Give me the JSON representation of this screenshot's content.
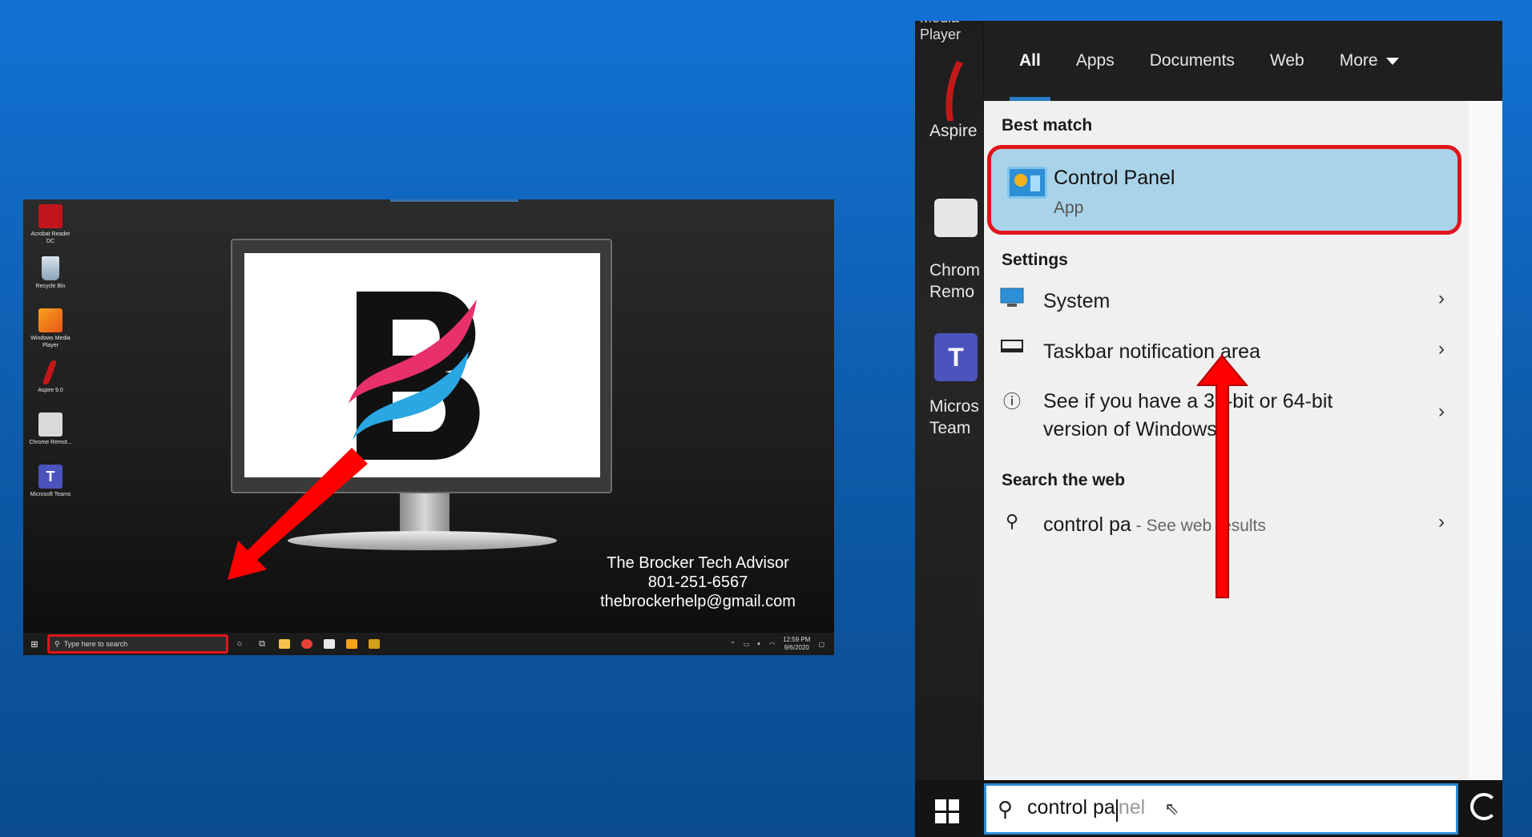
{
  "left": {
    "desktop_icons": [
      {
        "label": "Acrobat Reader DC",
        "icon": "acrobat-icon"
      },
      {
        "label": "Recycle Bin",
        "icon": "recycle-bin-icon"
      },
      {
        "label": "Windows Media Player",
        "icon": "media-player-icon"
      },
      {
        "label": "Aspire 9.0",
        "icon": "aspire-icon"
      },
      {
        "label": "Chrome Remot...",
        "icon": "chrome-remote-icon"
      },
      {
        "label": "Microsoft Teams",
        "icon": "teams-icon"
      }
    ],
    "brand": {
      "name": "The Brocker Tech Advisor",
      "phone": "801-251-6567",
      "email": "thebrockerhelp@gmail.com"
    },
    "taskbar": {
      "search_placeholder": "Type here to search",
      "time": "12:59 PM",
      "date": "9/6/2020"
    },
    "colors": {
      "highlight": "#e0151b",
      "arrow": "#ff0000"
    }
  },
  "right": {
    "desktop_labels": {
      "media_player_cut": "Media Player",
      "aspire": "Aspire",
      "chrome_1": "Chrom",
      "chrome_2": "Remo",
      "teams_1": "Micros",
      "teams_2": "Team"
    },
    "tabs": [
      "All",
      "Apps",
      "Documents",
      "Web",
      "More"
    ],
    "best_match_title": "Best match",
    "best_match": {
      "title": "Control Panel",
      "subtitle": "App"
    },
    "settings_title": "Settings",
    "settings": [
      {
        "icon": "monitor-icon",
        "label": "System"
      },
      {
        "icon": "taskbar-icon",
        "label": "Taskbar notification area"
      },
      {
        "icon": "info-icon",
        "label": "See if you have a 32-bit or 64-bit version of Windows"
      }
    ],
    "search_web_title": "Search the web",
    "web_result": {
      "query": "control pa",
      "suffix": " - See web results"
    },
    "search_box": {
      "typed": "control pa",
      "ghost": "nel"
    },
    "colors": {
      "accent": "#2a7cc7",
      "best_match_bg": "#a9d3e8",
      "highlight": "#e0151b"
    }
  }
}
